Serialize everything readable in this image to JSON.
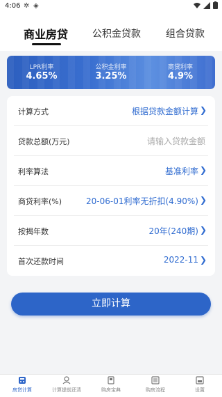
{
  "status_bar": {
    "time": "4:06"
  },
  "tabs": [
    {
      "label": "商业房贷"
    },
    {
      "label": "公积金贷款"
    },
    {
      "label": "组合贷款"
    }
  ],
  "rates": [
    {
      "label": "LPR利率",
      "value": "4.65%"
    },
    {
      "label": "公积金利率",
      "value": "3.25%"
    },
    {
      "label": "商贷利率",
      "value": "4.9%"
    }
  ],
  "form": {
    "calc_method": {
      "label": "计算方式",
      "value": "根据贷款金额计算"
    },
    "loan_amount": {
      "label": "贷款总额(万元)",
      "placeholder": "请输入贷款金额"
    },
    "rate_method": {
      "label": "利率算法",
      "value": "基准利率"
    },
    "commercial_rate": {
      "label": "商贷利率(%)",
      "value": "20-06-01利率无折扣(4.90%)"
    },
    "term": {
      "label": "按揭年数",
      "value": "20年(240期)"
    },
    "first_payment": {
      "label": "首次还款时间",
      "value": "2022-11"
    }
  },
  "calculate_button": {
    "label": "立即计算"
  },
  "bottom_nav": [
    {
      "label": "房贷计算",
      "icon": "calculator-icon"
    },
    {
      "label": "计算提前还清",
      "icon": "repay-icon"
    },
    {
      "label": "购房宝典",
      "icon": "book-icon"
    },
    {
      "label": "购房流程",
      "icon": "list-icon"
    },
    {
      "label": "设置",
      "icon": "settings-icon"
    }
  ],
  "colors": {
    "accent": "#2d65c8",
    "banner": "#3a6fd0",
    "value_text": "#2f6bd0"
  }
}
